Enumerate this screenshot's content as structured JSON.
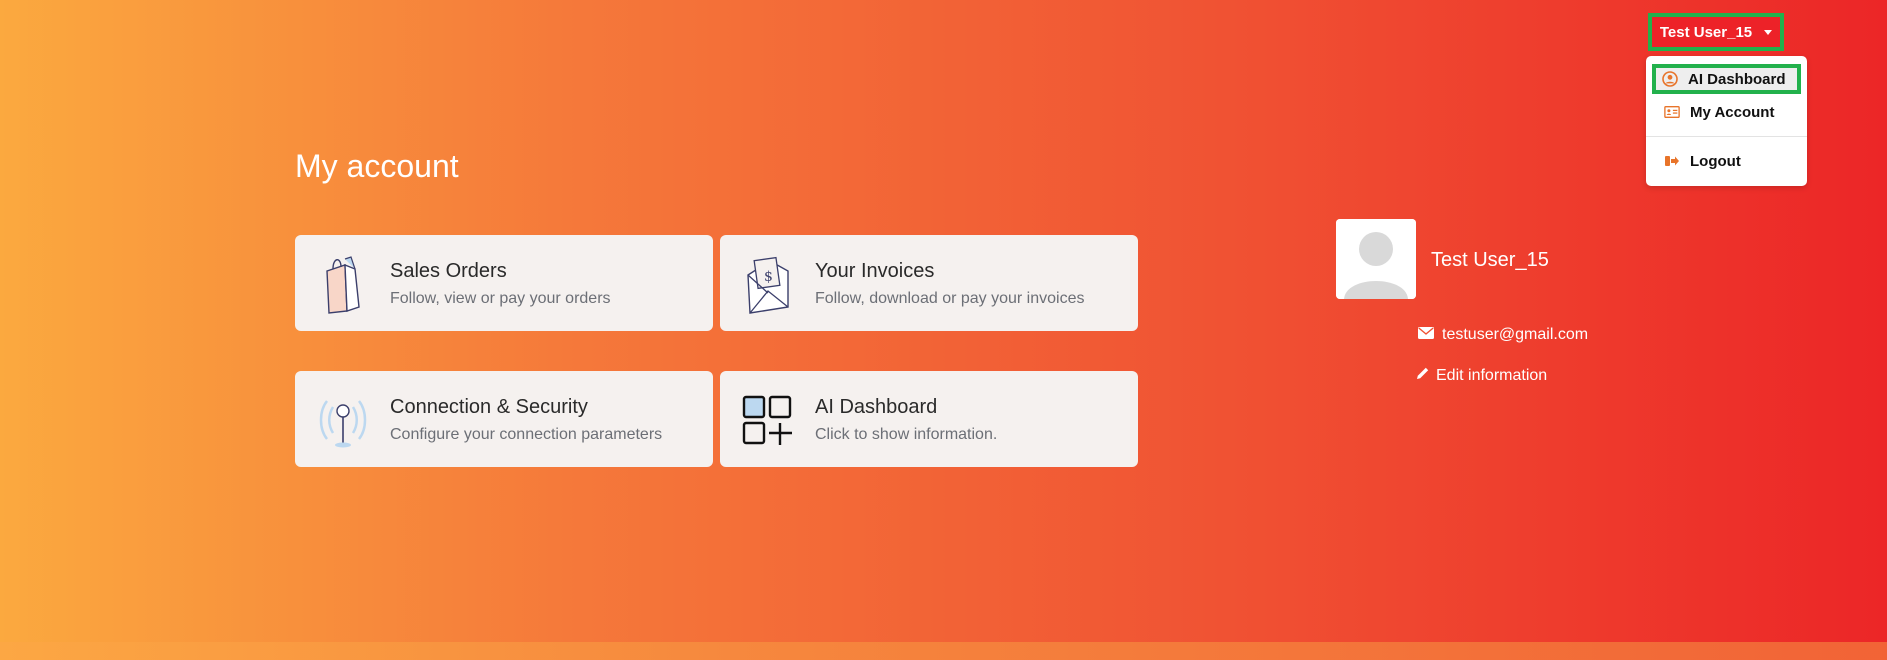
{
  "header": {
    "user_menu_label": "Test User_15",
    "menu": {
      "items": [
        {
          "label": "AI Dashboard",
          "icon": "user-circle-icon"
        },
        {
          "label": "My Account",
          "icon": "id-card-icon"
        },
        {
          "label": "Logout",
          "icon": "sign-out-icon"
        }
      ]
    }
  },
  "main": {
    "title": "My account",
    "cards": [
      {
        "title": "Sales Orders",
        "description": "Follow, view or pay your orders",
        "icon": "shopping-bag-icon"
      },
      {
        "title": "Your Invoices",
        "description": "Follow, download or pay your invoices",
        "icon": "invoice-envelope-icon"
      },
      {
        "title": "Connection & Security",
        "description": "Configure your connection parameters",
        "icon": "antenna-icon"
      },
      {
        "title": "AI Dashboard",
        "description": "Click to show information.",
        "icon": "dashboard-grid-icon"
      }
    ]
  },
  "profile": {
    "name": "Test User_15",
    "email": "testuser@gmail.com",
    "edit_label": "Edit information"
  },
  "colors": {
    "accent_red": "#ed2228",
    "highlight_green": "#22b14c",
    "icon_orange": "#e8742a"
  }
}
